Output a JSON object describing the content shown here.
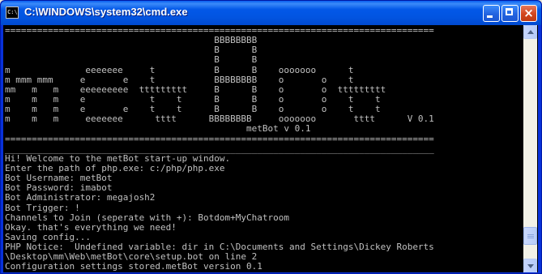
{
  "window": {
    "title": "C:\\WINDOWS\\system32\\cmd.exe",
    "app_icon_text": "C:\\"
  },
  "captions": {
    "minimize": "_",
    "maximize": "□",
    "close": "×"
  },
  "console": {
    "text_color": "#C0C0C0",
    "background": "#000000",
    "lines": [
      "================================================================================",
      "                                       BBBBBBBB",
      "                                       B      B",
      "                                       B      B",
      "m              eeeeeee     t           B      B    ooooooo      t",
      "m mmm mmm     e       e    t           BBBBBBBB    o       o    t",
      "mm   m   m    eeeeeeeee  ttttttttt     B      B    o       o  ttttttttt",
      "m    m   m    e            t    t      B      B    o       o    t    t",
      "m    m   m    e       e    t    t      B      B    o       o    t    t",
      "m    m   m     eeeeeee      tttt      BBBBBBBB     ooooooo       tttt      V 0.1",
      "                                             metBot v 0.1",
      "================================================================================",
      "________________________________________________________________________________",
      "Hi! Welcome to the metBot start-up window.",
      "Enter the path of php.exe: c:/php/php.exe",
      "Bot Username: metBot",
      "Bot Password: imabot",
      "Bot Administrator: megajosh2",
      "Bot Trigger: !",
      "Channels to Join (seperate with +): Botdom+MyChatroom",
      "Okay. that's everything we need!",
      "Saving config...",
      "PHP Notice:  Undefined variable: dir in C:\\Documents and Settings\\Dickey Roberts",
      "\\Desktop\\mm\\Web\\metBot\\core\\setup.bot on line 2",
      "Configuration settings stored.metBot version 0.1",
      ""
    ]
  },
  "scrollbar": {
    "position_fraction": 0.93,
    "visible_fraction": 0.08
  }
}
